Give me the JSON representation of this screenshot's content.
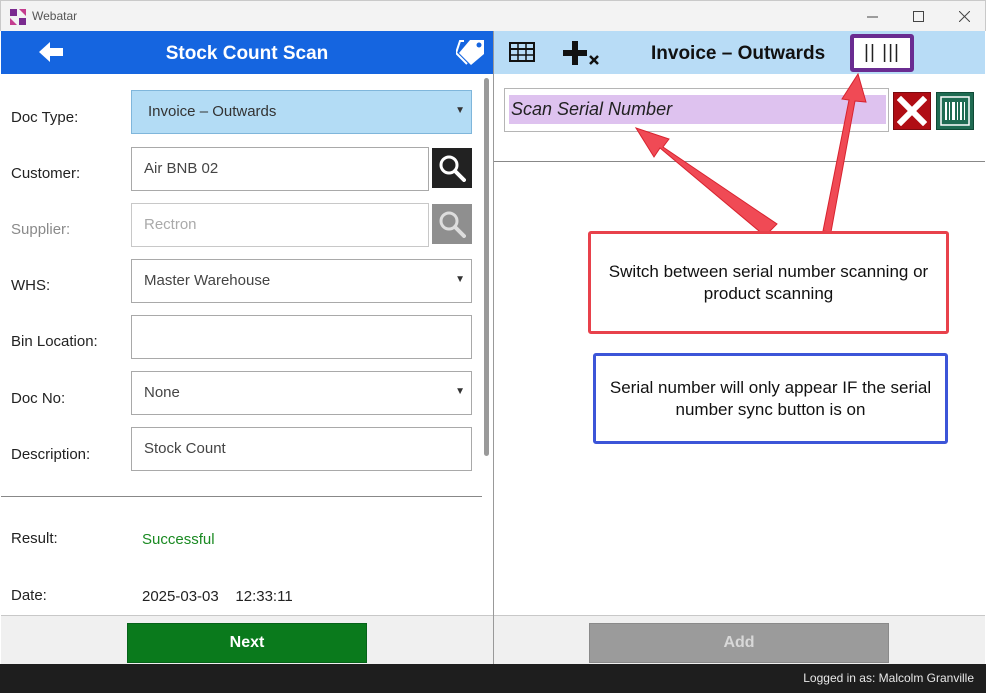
{
  "window": {
    "title": "Webatar",
    "controls": [
      "minimize",
      "maximize",
      "close"
    ]
  },
  "left": {
    "header": {
      "title": "Stock Count Scan",
      "back_icon": "arrow-left-icon",
      "tag_icon": "tags-icon"
    },
    "form": {
      "doc_type": {
        "label": "Doc Type:",
        "value": "Invoice – Outwards"
      },
      "customer": {
        "label": "Customer:",
        "value": "Air BNB 02"
      },
      "supplier": {
        "label": "Supplier:",
        "value": "Rectron",
        "disabled": true
      },
      "whs": {
        "label": "WHS:",
        "value": "Master Warehouse"
      },
      "bin_location": {
        "label": "Bin Location:",
        "value": ""
      },
      "doc_no": {
        "label": "Doc No:",
        "value": "None"
      },
      "description": {
        "label": "Description:",
        "value": "Stock Count"
      }
    },
    "result": {
      "label": "Result:",
      "value": "Successful",
      "color": "#1a8a22"
    },
    "date": {
      "label": "Date:",
      "value": "2025-03-03    12:33:11"
    },
    "next_label": "Next"
  },
  "right": {
    "header": {
      "title": "Invoice – Outwards",
      "mode_label": "|| |||",
      "grid_icon": "table-icon",
      "add_icon": "add-clear-icon"
    },
    "scan": {
      "placeholder": "Scan Serial Number"
    },
    "callouts": {
      "switch_mode": "Switch between serial number scanning or product scanning",
      "serial_info": "Serial number will only appear IF the serial number sync button is on"
    },
    "add_label": "Add"
  },
  "status": {
    "logged_in": "Logged in as: Malcolm Granville"
  },
  "colors": {
    "left_header": "#1565e0",
    "right_header": "#b8dcf6",
    "next_button": "#0a7a1c",
    "scan_highlight": "#dec2ef",
    "mode_button_border": "#6a2c91",
    "callout_red": "#e8414b",
    "callout_blue": "#3c55d8"
  }
}
